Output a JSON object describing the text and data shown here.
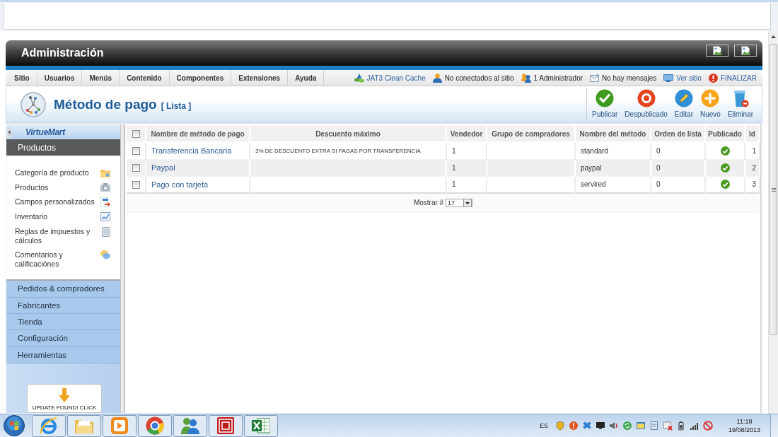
{
  "header": {
    "title": "Administración"
  },
  "menu": {
    "items": [
      "Sitio",
      "Usuarios",
      "Menús",
      "Contenido",
      "Componentes",
      "Extensiones",
      "Ayuda"
    ],
    "status": [
      {
        "label": "JAT3 Clean Cache",
        "link": true
      },
      {
        "label": "No conectados al sitio",
        "link": false
      },
      {
        "label": "1 Administrador",
        "link": false
      },
      {
        "label": "No hay mensajes",
        "link": false
      },
      {
        "label": "Ver sitio",
        "link": true
      },
      {
        "label": "FINALIZAR",
        "link": true
      }
    ]
  },
  "page": {
    "title": "Método de pago",
    "subtitle": "[ Lista ]"
  },
  "toolbar": {
    "buttons": [
      {
        "label": "Publicar"
      },
      {
        "label": "Despublicado"
      },
      {
        "label": "Editar"
      },
      {
        "label": "Nuevo"
      },
      {
        "label": "Eliminar"
      }
    ]
  },
  "sidebar": {
    "logo": "VirtueMart",
    "sections": [
      {
        "label": "Productos",
        "expanded": true,
        "items": [
          "Categoría de producto",
          "Productos",
          "Campos personalizados",
          "Inventario",
          "Reglas de impuestos y cálculos",
          "Comentarios y calificaciónes"
        ]
      },
      {
        "label": "Pedidos & compradores",
        "expanded": false
      },
      {
        "label": "Fabricantes",
        "expanded": false
      },
      {
        "label": "Tienda",
        "expanded": false
      },
      {
        "label": "Configuración",
        "expanded": false
      },
      {
        "label": "Herramientas",
        "expanded": false
      }
    ],
    "update_notice": "UPDATE FOUND! CLICK"
  },
  "table": {
    "select_all": {
      "checked": false
    },
    "columns": [
      "Nombre de método de pago",
      "Descuento máximo",
      "Vendedor",
      "Grupo de compradores",
      "Nombre del método",
      "Orden de lista",
      "Publicado",
      "Id"
    ],
    "rows": [
      {
        "checked": false,
        "name": "Transferencia Bancaria",
        "discount": "3% DE DESCUENTO EXTRA SI PAGAS POR TRANSFERENCIA",
        "vendor": "1",
        "method": "standard",
        "order": "0",
        "published": true,
        "id": "1"
      },
      {
        "checked": false,
        "name": "Paypal",
        "vendor": "1",
        "method": "paypal",
        "order": "0",
        "published": true,
        "id": "2"
      },
      {
        "checked": false,
        "name": "Pago con tarjeta",
        "vendor": "1",
        "method": "servired",
        "order": "0",
        "published": true,
        "id": "3"
      }
    ]
  },
  "pagination": {
    "label": "Mostrar #",
    "value": "17"
  },
  "taskbar": {
    "language": "ES",
    "time": "11:18",
    "date": "19/08/2013"
  }
}
